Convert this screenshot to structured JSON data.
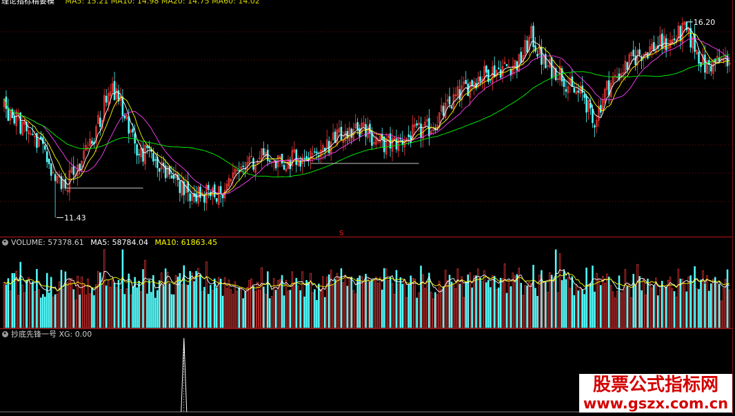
{
  "price_header": {
    "title": "理论指标精要模",
    "bg_text": "MA5: 15.21 MA10: 14.98 MA20: 14.75 MA60: 14.02"
  },
  "volume_header": {
    "volume_label": "VOLUME: 57378.61",
    "ma5_label": "MA5: 58784.04",
    "ma10_label": "MA10: 61863.45"
  },
  "indicator_header": {
    "label": "抄底先锋一号 XG: 0.00"
  },
  "watermark": {
    "line1": "股票公式指标网",
    "line2": "www.gszx.com.cn"
  },
  "colors": {
    "up": "#ff3a3a",
    "down": "#54ffff",
    "ma5": "#ffffff",
    "ma10": "#ffff00",
    "ma20": "#ff40ff",
    "ma60": "#00ff00",
    "separator": "#c01818",
    "grid": "#7a1010"
  },
  "chart_data": [
    {
      "type": "candlestick",
      "title": "",
      "annotations": [
        {
          "label": "11.43",
          "value": 11.43
        },
        {
          "label": "16.20",
          "value": 16.2
        }
      ],
      "ylim": [
        11.1,
        16.6
      ],
      "series": [
        {
          "name": "MA5",
          "color": "#ffffff"
        },
        {
          "name": "MA10",
          "color": "#ffff00"
        },
        {
          "name": "MA20",
          "color": "#ff40ff"
        },
        {
          "name": "MA60",
          "color": "#00ff00"
        }
      ],
      "key_points": [
        [
          0,
          14.1
        ],
        [
          10,
          13.6
        ],
        [
          20,
          13.0
        ],
        [
          25,
          12.4
        ],
        [
          30,
          12.2
        ],
        [
          35,
          12.6
        ],
        [
          42,
          13.2
        ],
        [
          48,
          14.0
        ],
        [
          52,
          14.7
        ],
        [
          56,
          14.3
        ],
        [
          60,
          13.7
        ],
        [
          65,
          13.1
        ],
        [
          72,
          12.9
        ],
        [
          78,
          12.7
        ],
        [
          85,
          12.2
        ],
        [
          95,
          12.0
        ],
        [
          105,
          12.0
        ],
        [
          112,
          12.3
        ],
        [
          118,
          12.7
        ],
        [
          125,
          12.9
        ],
        [
          135,
          12.75
        ],
        [
          142,
          12.85
        ],
        [
          150,
          12.9
        ],
        [
          160,
          13.2
        ],
        [
          168,
          13.55
        ],
        [
          175,
          13.6
        ],
        [
          185,
          13.2
        ],
        [
          192,
          13.25
        ],
        [
          200,
          13.45
        ],
        [
          208,
          13.6
        ],
        [
          215,
          14.0
        ],
        [
          222,
          14.4
        ],
        [
          230,
          14.8
        ],
        [
          238,
          15.0
        ],
        [
          245,
          15.1
        ],
        [
          252,
          15.2
        ],
        [
          258,
          15.85
        ],
        [
          265,
          15.1
        ],
        [
          272,
          15.0
        ],
        [
          278,
          14.5
        ],
        [
          284,
          14.4
        ],
        [
          288,
          13.7
        ],
        [
          295,
          14.6
        ],
        [
          302,
          15.0
        ],
        [
          310,
          15.4
        ],
        [
          318,
          15.6
        ],
        [
          326,
          15.7
        ],
        [
          333,
          16.0
        ],
        [
          338,
          15.6
        ],
        [
          343,
          15.1
        ],
        [
          348,
          15.2
        ],
        [
          355,
          15.3
        ]
      ]
    },
    {
      "type": "bar",
      "title": "",
      "series": [
        {
          "name": "VOLUME",
          "value": 57378.61
        },
        {
          "name": "MA5",
          "value": 58784.04
        },
        {
          "name": "MA10",
          "value": 61863.45
        }
      ],
      "ylim": [
        0,
        120000
      ]
    },
    {
      "type": "line",
      "title": "",
      "series": [
        {
          "name": "XG",
          "last_value": 0.0
        }
      ],
      "spike_at_bar": 88,
      "ylim": [
        0,
        1
      ]
    }
  ]
}
